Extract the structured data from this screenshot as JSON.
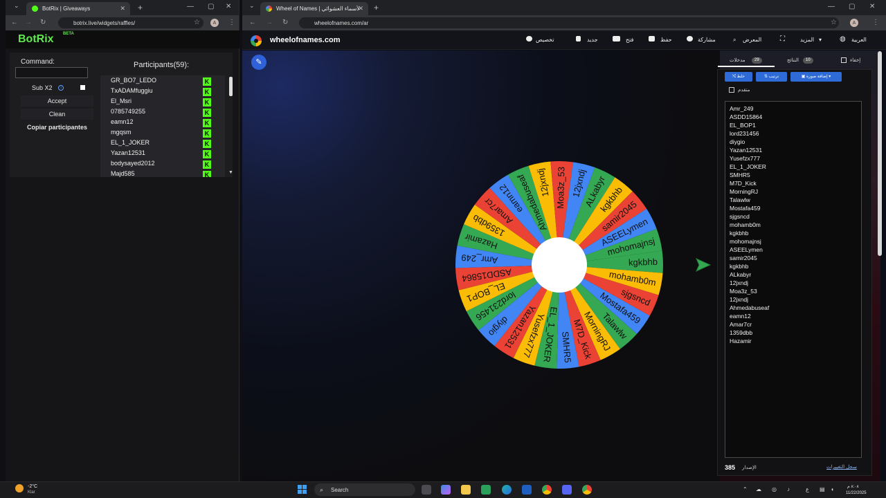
{
  "left_window": {
    "tab_title": "BotRix | Giveaways",
    "url": "botrix.live/widgets/raffles/",
    "avatar": "A"
  },
  "botrix": {
    "logo": "BotRix",
    "beta": "BETA",
    "command_label": "Command:",
    "command_value": "",
    "sub_label": "Sub X2",
    "accept_label": "Accept",
    "clean_label": "Clean",
    "copy_label": "Copiar participantes",
    "participants_title": "Participants(59):",
    "participants": [
      "GR_BO7_LEDO",
      "TxADAMfuggiu",
      "El_Msri",
      "0785749255",
      "eamn12",
      "mgqsm",
      "EL_1_JOKER",
      "Yazan12531",
      "bodysayed2012",
      "Majd585"
    ],
    "kick_badge": "K"
  },
  "right_window": {
    "tab_title": "Wheel of Names | عجلة الأسماء العشوائي",
    "url": "wheelofnames.com/ar",
    "avatar": "A"
  },
  "wheelofnames": {
    "site_title": "wheelofnames.com",
    "nav": {
      "customize": "تخصيص",
      "new": "جديد",
      "open": "فتح",
      "save": "حفظ",
      "share": "مشاركة",
      "gallery": "المعرض",
      "more": "المزيد",
      "language": "العربية"
    },
    "wheel_segments": [
      "kgkbhb",
      "mohamb0m",
      "sjgsncd",
      "Mostafa459",
      "Talawlw",
      "MorningRJ",
      "M7D_Kick",
      "SMHR5",
      "EL_1_JOKER",
      "Yusefzx777",
      "Yazan12531",
      "diygio",
      "lord231456",
      "EL_BOP1",
      "ASDD15864",
      "Amr_249",
      "Hazamir",
      "1359dbb",
      "Amar7cr",
      "eamn12",
      "Ahmedabuseaf",
      "12jxndj",
      "Moa3z_53",
      "12jxndj",
      "ALkabyr",
      "kgkbhb",
      "samir2045",
      "ASEELymen",
      "mohomajnsj"
    ],
    "segment_colors": [
      "#34a853",
      "#fbbc05",
      "#ea4335",
      "#4285f4"
    ],
    "side_panel": {
      "hide_label": "إخفاء",
      "results_label": "النتائج",
      "results_count": "10",
      "entries_label": "مدخلات",
      "entries_count": "29",
      "add_image_label": "إضافة صورة",
      "sort_label": "ترتيب",
      "shuffle_label": "خلط",
      "advanced_label": "متقدم",
      "entries": [
        "Amr_249",
        "ASDD15864",
        "EL_BOP1",
        "lord231456",
        "diygio",
        "Yazan12531",
        "Yusefzx777",
        "EL_1_JOKER",
        "SMHR5",
        "M7D_Kick",
        "MorningRJ",
        "Talawlw",
        "Mostafa459",
        "sjgsncd",
        "mohamb0m",
        "kgkbhb",
        "mohomajnsj",
        "ASEELymen",
        "samir2045",
        "kgkbhb",
        "ALkabyr",
        "12jxndj",
        "Moa3z_53",
        "12jxndj",
        "Ahmedabuseaf",
        "eamn12",
        "Amar7cr",
        "1359dbb",
        "Hazamir"
      ],
      "version_label": "الإصدار",
      "version_number": "385",
      "history_link": "سجل التغييرات"
    }
  },
  "taskbar": {
    "temp": "-2°C",
    "weather": "Klar",
    "search_placeholder": "Search",
    "lang": "ع",
    "time": "٨:٠٨ م",
    "date": "11/22/2025"
  }
}
